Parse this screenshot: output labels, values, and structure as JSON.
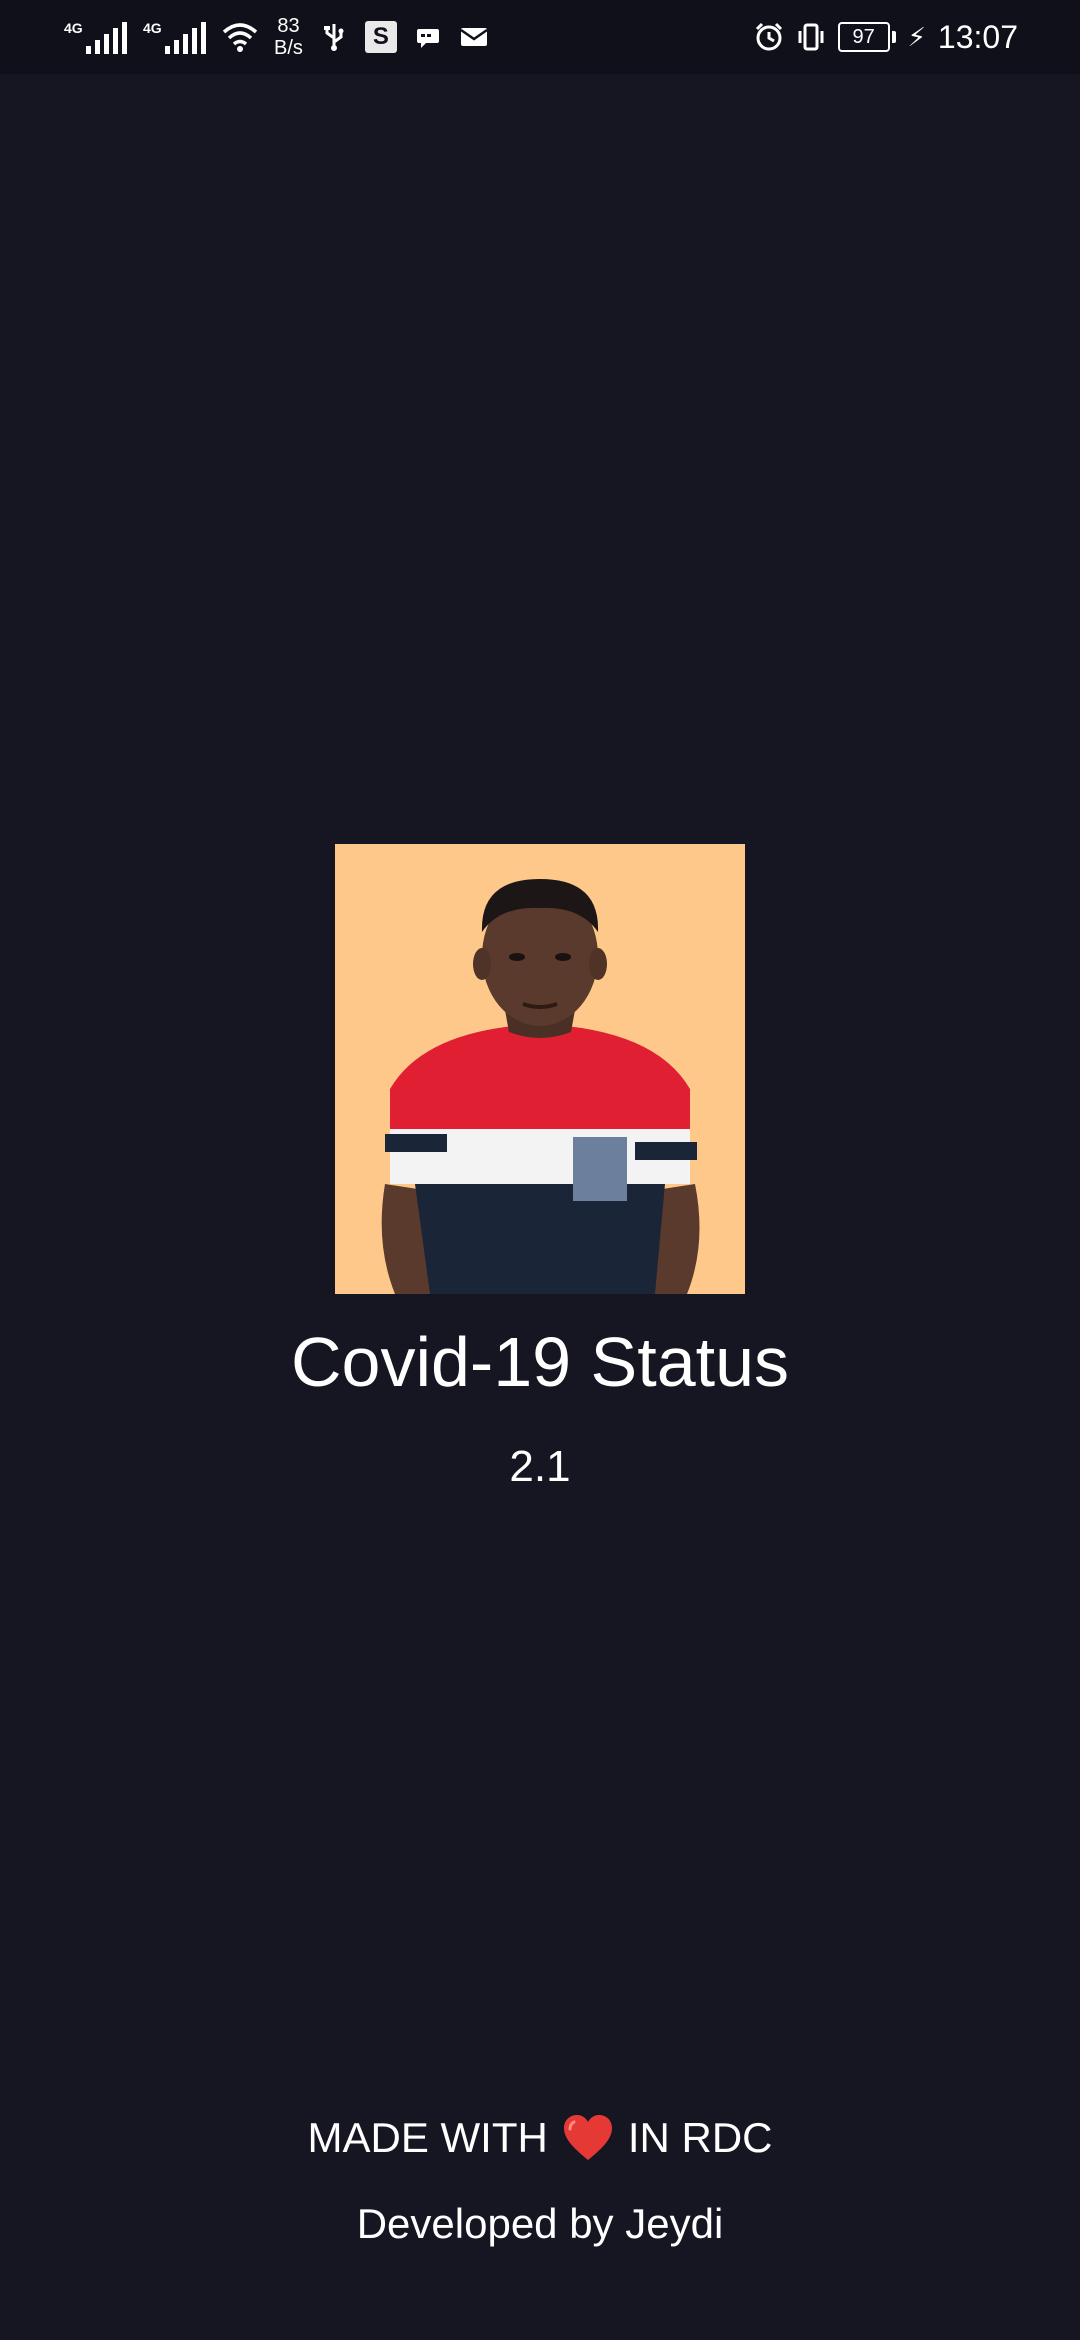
{
  "status_bar": {
    "network_gen_1": "4G",
    "network_gen_2": "4G",
    "speed_value": "83",
    "speed_unit": "B/s",
    "s_badge": "S",
    "battery_level": "97",
    "time": "13:07"
  },
  "app": {
    "title": "Covid-19 Status",
    "version": "2.1"
  },
  "footer": {
    "made_with_prefix": "MADE WITH",
    "made_with_suffix": "IN RDC",
    "developed_by": "Developed by Jeydi"
  },
  "colors": {
    "background": "#161522",
    "status_bar": "#10101a",
    "photo_background": "#fec88a",
    "heart": "#e53935"
  },
  "icons": {
    "signal": "signal-icon",
    "wifi": "wifi-icon",
    "usb": "usb-icon",
    "sms": "message-icon",
    "mail": "mail-icon",
    "alarm": "alarm-icon",
    "vibrate": "vibrate-icon",
    "charging": "charging-bolt-icon",
    "heart": "heart-icon"
  }
}
